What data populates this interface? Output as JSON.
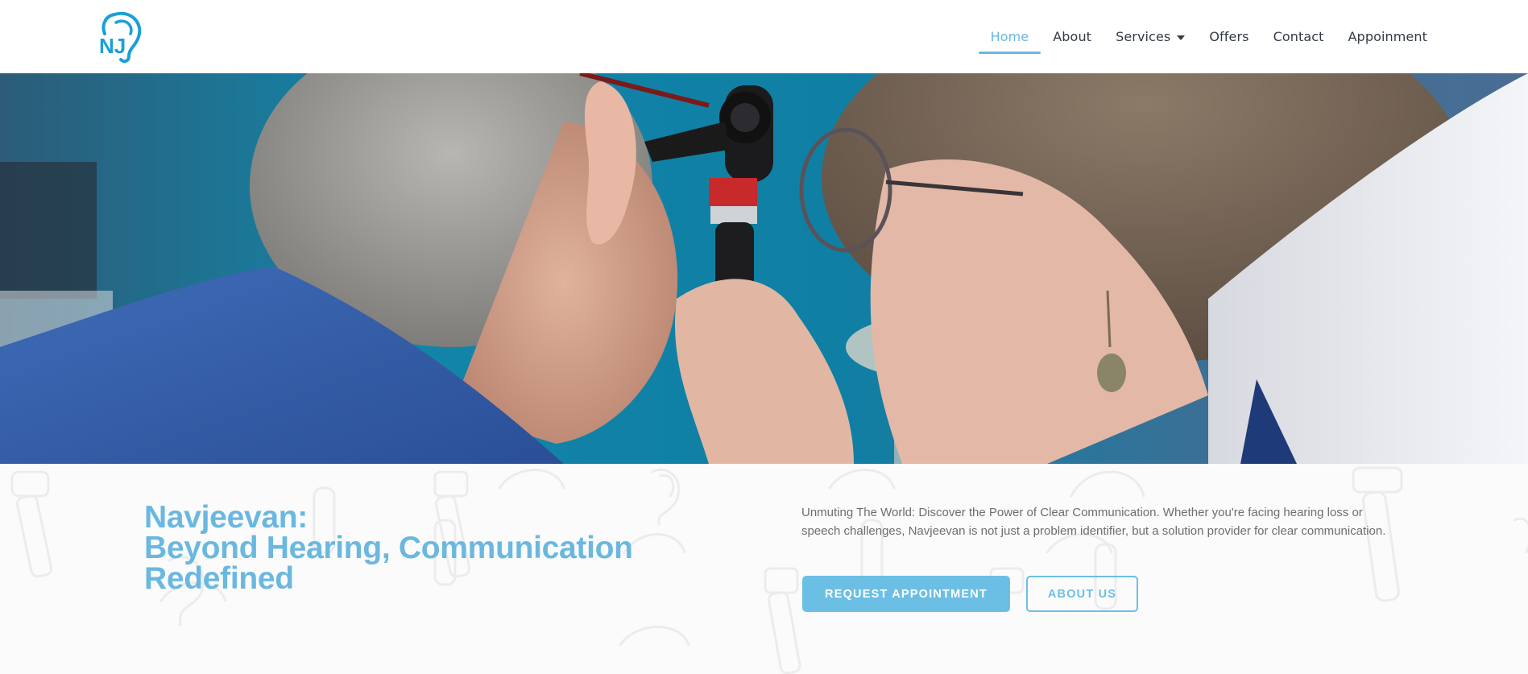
{
  "brand": {
    "logo_text": "NJ",
    "accent_color": "#6ab8e0",
    "logo_color": "#1aa0d8"
  },
  "nav": {
    "items": [
      {
        "label": "Home",
        "active": true
      },
      {
        "label": "About"
      },
      {
        "label": "Services",
        "has_dropdown": true
      },
      {
        "label": "Offers"
      },
      {
        "label": "Contact"
      },
      {
        "label": "Appoinment"
      }
    ]
  },
  "hero": {
    "image_alt": "Audiologist examining a patient's ear with an otoscope"
  },
  "intro": {
    "headline_line1": "Navjeevan:",
    "headline_line2": "Beyond Hearing, Communication",
    "headline_line3": "Redefined",
    "description": "Unmuting The World: Discover the Power of Clear Communication. Whether you're facing hearing loss or speech challenges, Navjeevan is not just a problem identifier, but a solution provider for clear communication.",
    "primary_button": "REQUEST APPOINTMENT",
    "secondary_button": "ABOUT US"
  }
}
